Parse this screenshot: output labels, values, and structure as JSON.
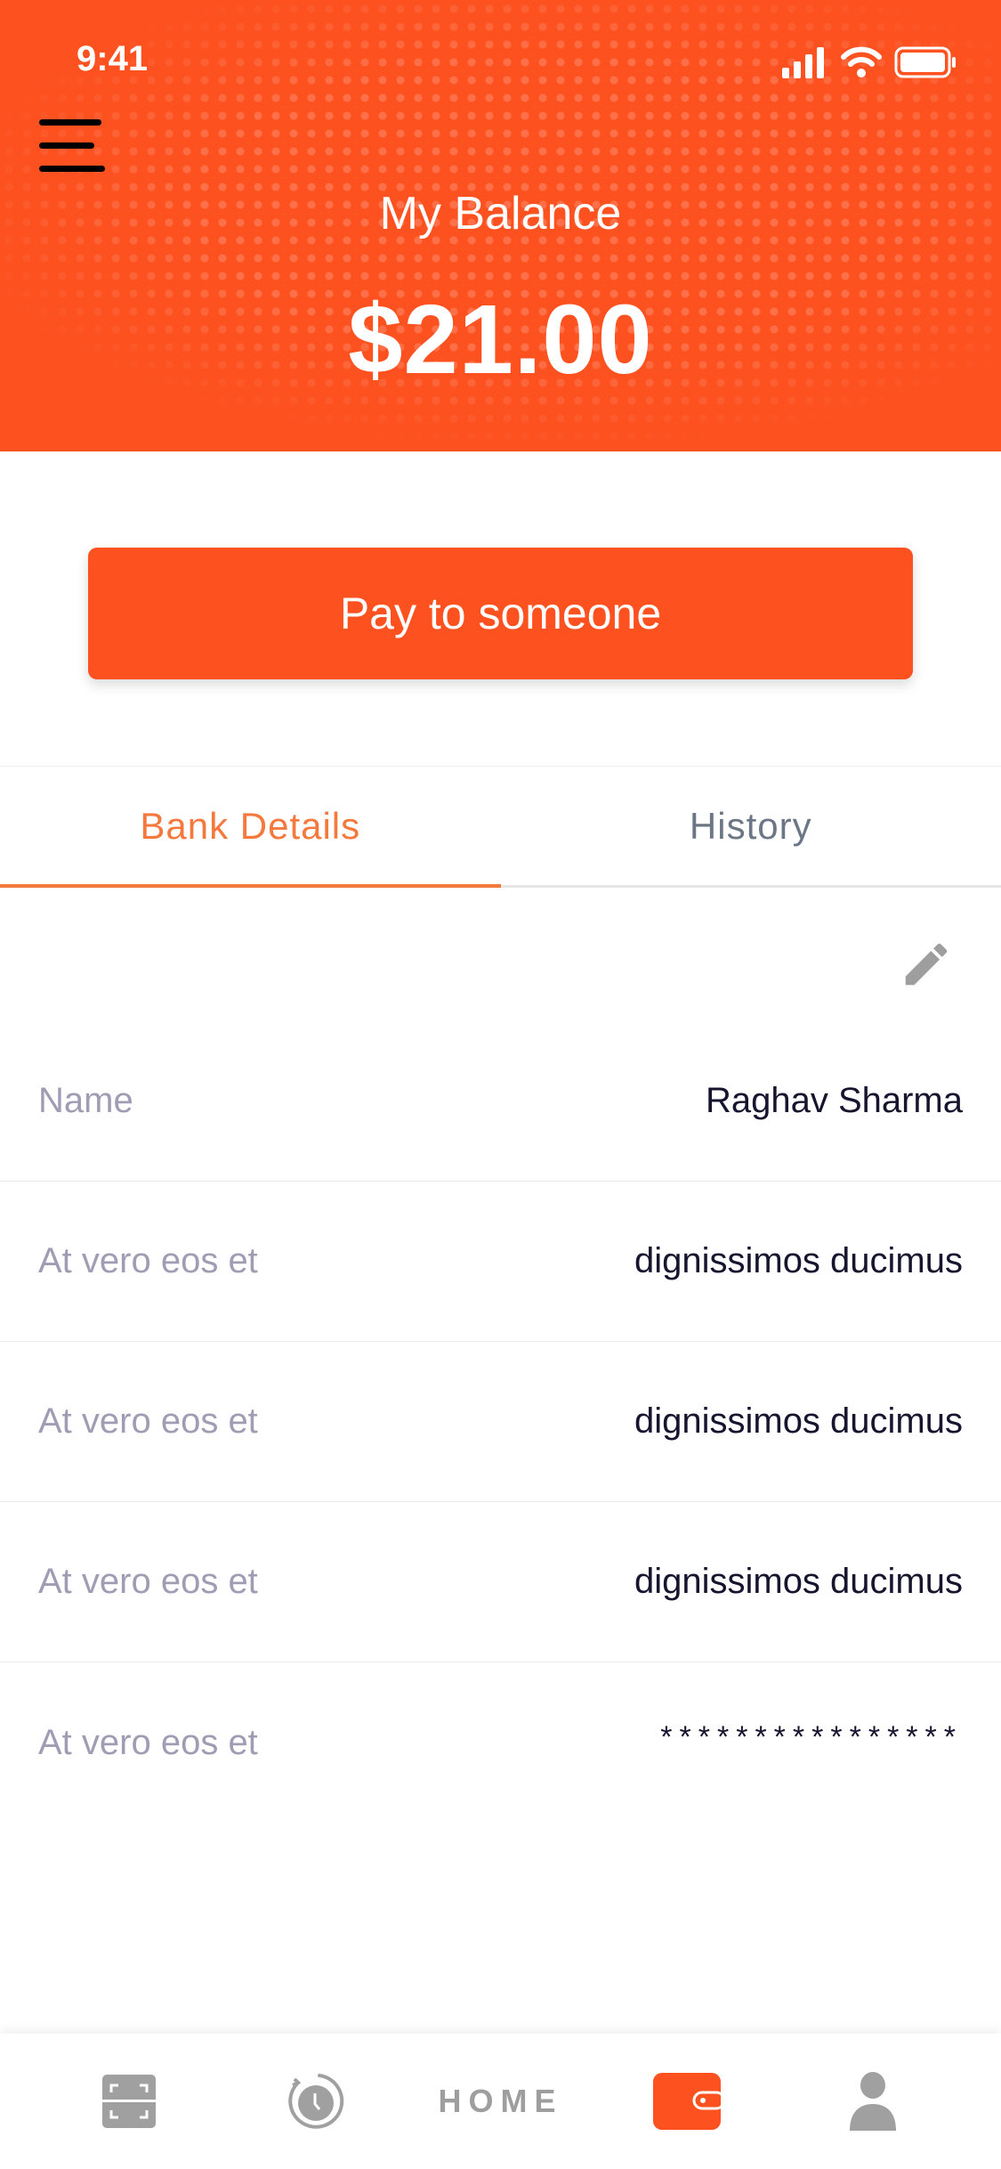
{
  "status_bar": {
    "time": "9:41"
  },
  "header": {
    "title": "My Balance",
    "balance": "$21.00",
    "color": "#FD5120"
  },
  "actions": {
    "pay_label": "Pay to someone"
  },
  "tabs": [
    {
      "label": "Bank Details",
      "active": true
    },
    {
      "label": "History",
      "active": false
    }
  ],
  "details": [
    {
      "label": "Name",
      "value": "Raghav Sharma"
    },
    {
      "label": "At vero eos et",
      "value": "dignissimos ducimus"
    },
    {
      "label": "At vero eos et",
      "value": "dignissimos ducimus"
    },
    {
      "label": "At vero eos et",
      "value": "dignissimos ducimus"
    },
    {
      "label": "At vero eos et",
      "value": "****************"
    }
  ],
  "bottom_nav": {
    "items": [
      "scan-icon",
      "history-icon",
      "HOME",
      "wallet-icon",
      "profile-icon"
    ],
    "home_label": "HOME",
    "active": "wallet"
  }
}
